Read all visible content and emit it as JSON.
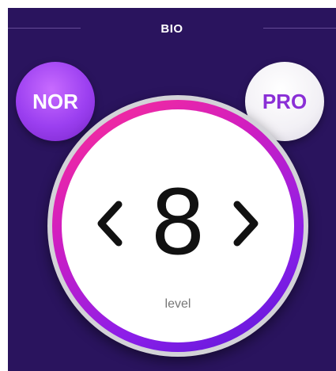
{
  "header": {
    "title": "BIO"
  },
  "modes": {
    "nor_label": "NOR",
    "pro_label": "PRO"
  },
  "dial": {
    "value": "8",
    "label": "level",
    "prev_icon": "chevron-left-icon",
    "next_icon": "chevron-right-icon"
  },
  "colors": {
    "background": "#2a145e",
    "nor_button": "#9b3ff0",
    "pro_text": "#8a2fd6",
    "ring_start": "#ff2f93",
    "ring_end": "#5618d8"
  }
}
